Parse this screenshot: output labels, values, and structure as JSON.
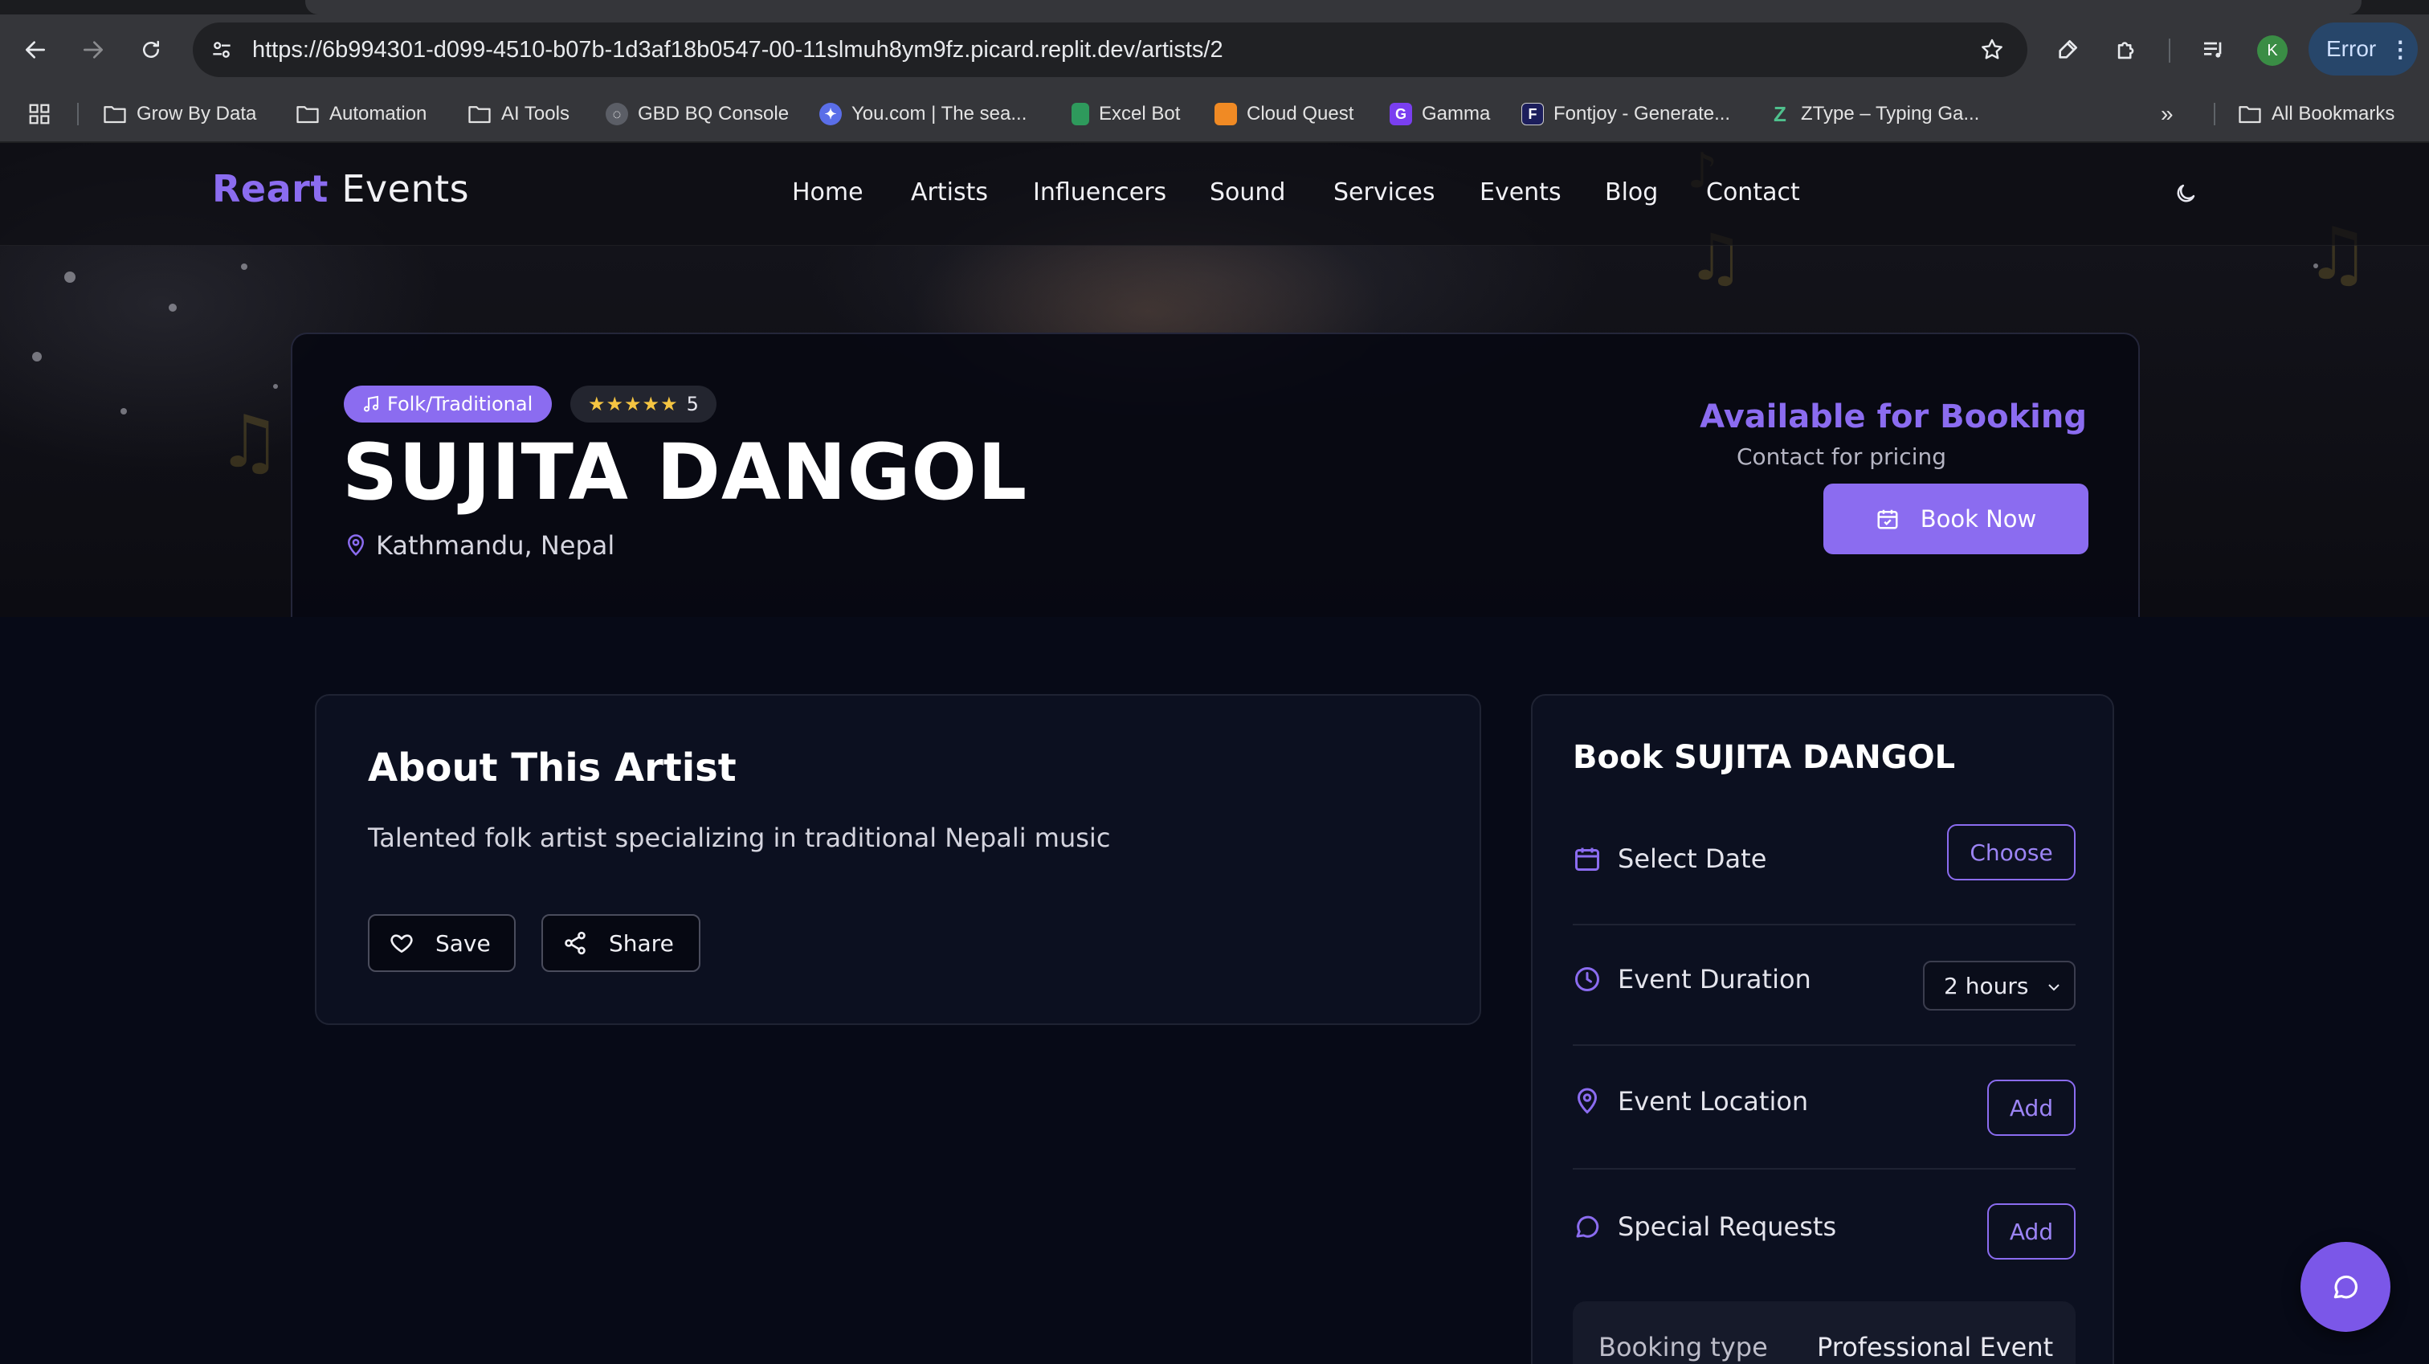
{
  "browser": {
    "url": "https://6b994301-d099-4510-b07b-1d3af18b0547-00-11slmuh8ym9fz.picard.replit.dev/artists/2",
    "profile_initial": "K",
    "error_label": "Error",
    "bookmarks": [
      {
        "label": "Grow By Data",
        "icon": "folder-icon"
      },
      {
        "label": "Automation",
        "icon": "folder-icon"
      },
      {
        "label": "AI Tools",
        "icon": "folder-icon"
      },
      {
        "label": "GBD BQ Console",
        "icon": "bigquery-icon"
      },
      {
        "label": "You.com | The sea...",
        "icon": "you-com-icon"
      },
      {
        "label": "Excel Bot",
        "icon": "excel-bot-icon"
      },
      {
        "label": "Cloud Quest",
        "icon": "cloud-quest-icon"
      },
      {
        "label": "Gamma",
        "icon": "gamma-icon"
      },
      {
        "label": "Fontjoy - Generate...",
        "icon": "fontjoy-icon"
      },
      {
        "label": "ZType – Typing Ga...",
        "icon": "ztype-icon"
      }
    ],
    "all_bookmarks_label": "All Bookmarks"
  },
  "site": {
    "logo_part1": "Reart",
    "logo_part2": "Events",
    "nav": [
      "Home",
      "Artists",
      "Influencers",
      "Sound",
      "Services",
      "Events",
      "Blog",
      "Contact"
    ],
    "accent_color": "#8b6cf0"
  },
  "hero": {
    "genre": "Folk/Traditional",
    "stars": "★★★★★",
    "rating": "5",
    "name": "SUJITA DANGOL",
    "location": "Kathmandu, Nepal",
    "availability": "Available for Booking",
    "pricing": "Contact for pricing",
    "book_now": "Book Now"
  },
  "about": {
    "title": "About This Artist",
    "description": "Talented folk artist specializing in traditional Nepali music",
    "save": "Save",
    "share": "Share"
  },
  "booking": {
    "title": "Book SUJITA DANGOL",
    "date_label": "Select Date",
    "date_button": "Choose",
    "duration_label": "Event Duration",
    "duration_value": "2 hours",
    "location_label": "Event Location",
    "location_button": "Add",
    "requests_label": "Special Requests",
    "requests_button": "Add",
    "summary_key": "Booking type",
    "summary_value": "Professional Event"
  }
}
